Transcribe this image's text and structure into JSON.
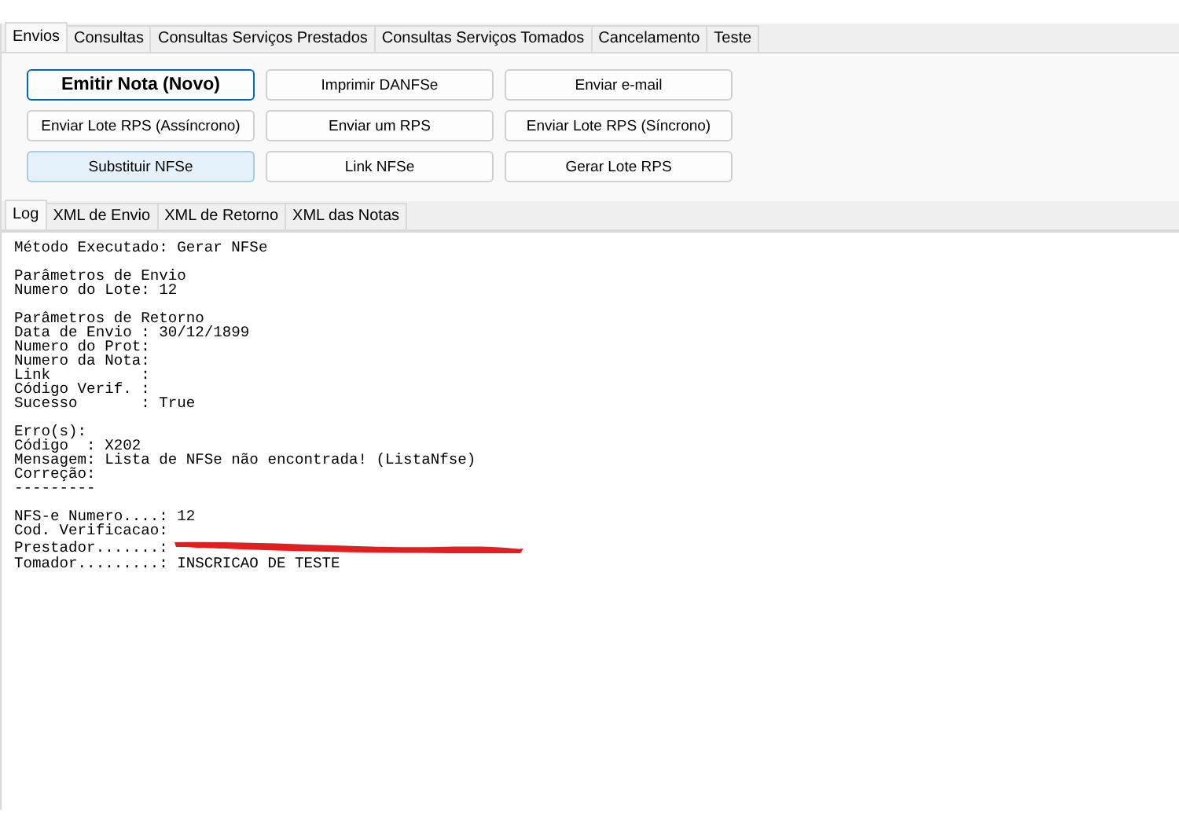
{
  "main_tabs": [
    {
      "label": "Envios",
      "selected": true
    },
    {
      "label": "Consultas",
      "selected": false
    },
    {
      "label": "Consultas Serviços Prestados",
      "selected": false
    },
    {
      "label": "Consultas Serviços Tomados",
      "selected": false
    },
    {
      "label": "Cancelamento",
      "selected": false
    },
    {
      "label": "Teste",
      "selected": false
    }
  ],
  "buttons": [
    {
      "label": "Emitir Nota (Novo)",
      "default": true,
      "hot": false
    },
    {
      "label": "Imprimir DANFSe",
      "default": false,
      "hot": false
    },
    {
      "label": "Enviar e-mail",
      "default": false,
      "hot": false
    },
    {
      "label": "Enviar Lote RPS (Assíncrono)",
      "default": false,
      "hot": false
    },
    {
      "label": "Enviar um RPS",
      "default": false,
      "hot": false
    },
    {
      "label": "Enviar Lote RPS (Síncrono)",
      "default": false,
      "hot": false
    },
    {
      "label": "Substituir NFSe",
      "default": false,
      "hot": true
    },
    {
      "label": "Link NFSe",
      "default": false,
      "hot": false
    },
    {
      "label": "Gerar Lote RPS",
      "default": false,
      "hot": false
    }
  ],
  "log_tabs": [
    {
      "label": "Log",
      "selected": true
    },
    {
      "label": "XML de Envio",
      "selected": false
    },
    {
      "label": "XML de Retorno",
      "selected": false
    },
    {
      "label": "XML das Notas",
      "selected": false
    }
  ],
  "log": [
    {
      "lines": [
        {
          "text": "Método Executado: Gerar NFSe",
          "redacted": false
        }
      ]
    },
    {
      "lines": [
        {
          "text": "Parâmetros de Envio",
          "redacted": false
        },
        {
          "text": "Numero do Lote: 12",
          "redacted": false
        }
      ]
    },
    {
      "lines": [
        {
          "text": "Parâmetros de Retorno",
          "redacted": false
        },
        {
          "text": "Data de Envio : 30/12/1899",
          "redacted": false
        },
        {
          "text": "Numero do Prot:",
          "redacted": false
        },
        {
          "text": "Numero da Nota:",
          "redacted": false
        },
        {
          "text": "Link          :",
          "redacted": false
        },
        {
          "text": "Código Verif. :",
          "redacted": false
        },
        {
          "text": "Sucesso       : True",
          "redacted": false
        }
      ]
    },
    {
      "lines": [
        {
          "text": "Erro(s):",
          "redacted": false
        },
        {
          "text": "Código  : X202",
          "redacted": false
        },
        {
          "text": "Mensagem: Lista de NFSe não encontrada! (ListaNfse)",
          "redacted": false
        },
        {
          "text": "Correção:",
          "redacted": false
        },
        {
          "text": "---------",
          "redacted": false
        }
      ]
    },
    {
      "lines": [
        {
          "text": "NFS-e Numero....: 12",
          "redacted": false
        },
        {
          "text": "Cod. Verificacao:",
          "redacted": false
        },
        {
          "text": "Prestador.......:",
          "redacted": true
        },
        {
          "text": "Tomador.........: INSCRICAO DE TESTE",
          "redacted": false
        }
      ]
    }
  ]
}
